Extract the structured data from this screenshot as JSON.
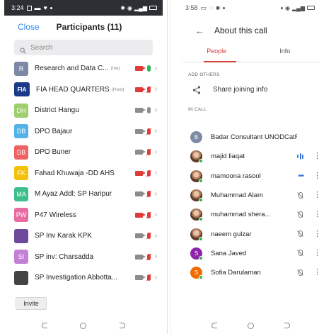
{
  "left_phone": {
    "status_time": "3:24",
    "header": {
      "close_label": "Close",
      "title": "Participants (11)"
    },
    "search": {
      "placeholder": "Search"
    },
    "participants": [
      {
        "initials": "R",
        "name": "Research and Data C...",
        "tag": "(me)",
        "color": "#7e8aa5",
        "video": "off",
        "mic": "on"
      },
      {
        "initials": "FIA",
        "name": "FIA HEAD QUARTERS",
        "tag": "(Host)",
        "color": "#1b3a8a",
        "video": "off",
        "mic": "muted"
      },
      {
        "initials": "DH",
        "name": "District Hangu",
        "tag": "",
        "color": "#9fcf6e",
        "video": "on",
        "mic": "idle"
      },
      {
        "initials": "DB",
        "name": "DPO Bajaur",
        "tag": "",
        "color": "#53b3e8",
        "video": "on",
        "mic": "muted"
      },
      {
        "initials": "DB",
        "name": "DPO Buner",
        "tag": "",
        "color": "#ef6262",
        "video": "on",
        "mic": "muted"
      },
      {
        "initials": "FK",
        "name": "Fahad Khuwaja -DD AHS",
        "tag": "",
        "color": "#f4c20d",
        "video": "off",
        "mic": "muted"
      },
      {
        "initials": "MA",
        "name": "M Ayaz Addl: SP Haripur",
        "tag": "",
        "color": "#3cbf8b",
        "video": "on",
        "mic": "muted"
      },
      {
        "initials": "PW",
        "name": "P47 Wireless",
        "tag": "",
        "color": "#e86ca2",
        "video": "off",
        "mic": "muted"
      },
      {
        "initials": "",
        "name": "SP Inv Karak KPK",
        "tag": "",
        "color": "#6d4a9c",
        "video": "on",
        "mic": "muted"
      },
      {
        "initials": "SI",
        "name": "SP inv: Charsadda",
        "tag": "",
        "color": "#c381d6",
        "video": "on",
        "mic": "muted"
      },
      {
        "initials": "",
        "name": "SP Investigation Abbotta...",
        "tag": "",
        "color": "#444444",
        "video": "on",
        "mic": "muted"
      }
    ],
    "invite_label": "Invite"
  },
  "right_phone": {
    "status_time": "3:58",
    "header": {
      "title": "About this call"
    },
    "tabs": [
      {
        "label": "People",
        "active": true
      },
      {
        "label": "Info",
        "active": false
      }
    ],
    "add_others_label": "ADD OTHERS",
    "share_label": "Share joining info",
    "in_call_label": "IN CALL",
    "people": [
      {
        "initial": "B",
        "name": "Badar Consultant UNODCatFl...",
        "color": "#7e8aa5",
        "status": "none",
        "photo": false
      },
      {
        "initial": "",
        "name": "majid liaqat",
        "color": "#b07a5a",
        "status": "speaking",
        "photo": true
      },
      {
        "initial": "",
        "name": "mamoona rasool",
        "color": "#d9a441",
        "status": "connecting",
        "photo": true
      },
      {
        "initial": "",
        "name": "Muhammad Alam",
        "color": "#a0522d",
        "status": "muted",
        "photo": true
      },
      {
        "initial": "",
        "name": "muhammad shera...",
        "color": "#6b6b6b",
        "status": "muted",
        "photo": true
      },
      {
        "initial": "",
        "name": "naeem gulzar",
        "color": "#c47a7a",
        "status": "muted",
        "photo": true
      },
      {
        "initial": "S",
        "name": "Sana Javed",
        "color": "#8e24aa",
        "status": "muted",
        "photo": false
      },
      {
        "initial": "S",
        "name": "Sofia Darulaman",
        "color": "#ef6c00",
        "status": "muted",
        "photo": false
      }
    ]
  },
  "colors": {
    "zoom_blue": "#2d8cf0",
    "meet_red": "#d8403a",
    "meet_blue": "#3c78d8",
    "mute_red": "#e03a3a",
    "unmuted_green": "#2db84d"
  }
}
